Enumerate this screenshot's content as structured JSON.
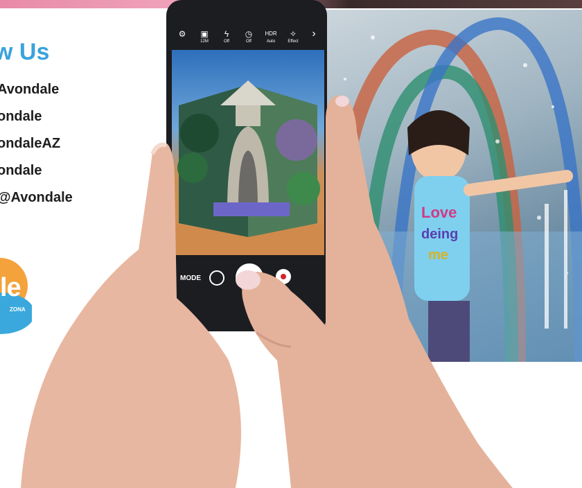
{
  "page": {
    "heading": "w Us",
    "handles": [
      "Avondale",
      "ondale",
      "ondaleAZ",
      "ondale",
      "@Avondale"
    ]
  },
  "logo": {
    "text": "le",
    "subtext": "ZONA"
  },
  "camera": {
    "topbar": [
      {
        "icon": "gear-icon",
        "glyph": "⚙",
        "value": ""
      },
      {
        "icon": "ratio-icon",
        "glyph": "▣",
        "value": "12M"
      },
      {
        "icon": "flash-icon",
        "glyph": "ϟ",
        "value": "Off"
      },
      {
        "icon": "timer-icon",
        "glyph": "◷",
        "value": "Off"
      },
      {
        "icon": "hdr-icon",
        "glyph": "HDR",
        "value": "Auto"
      },
      {
        "icon": "effect-icon",
        "glyph": "✧",
        "value": "Effect"
      },
      {
        "icon": "chevron-right-icon",
        "glyph": "›",
        "value": ""
      }
    ],
    "mode_label": "MODE"
  },
  "colors": {
    "heading": "#3aa2dc",
    "text": "#1d1d1d",
    "phone": "#1c1d21",
    "record": "#d3232e"
  }
}
